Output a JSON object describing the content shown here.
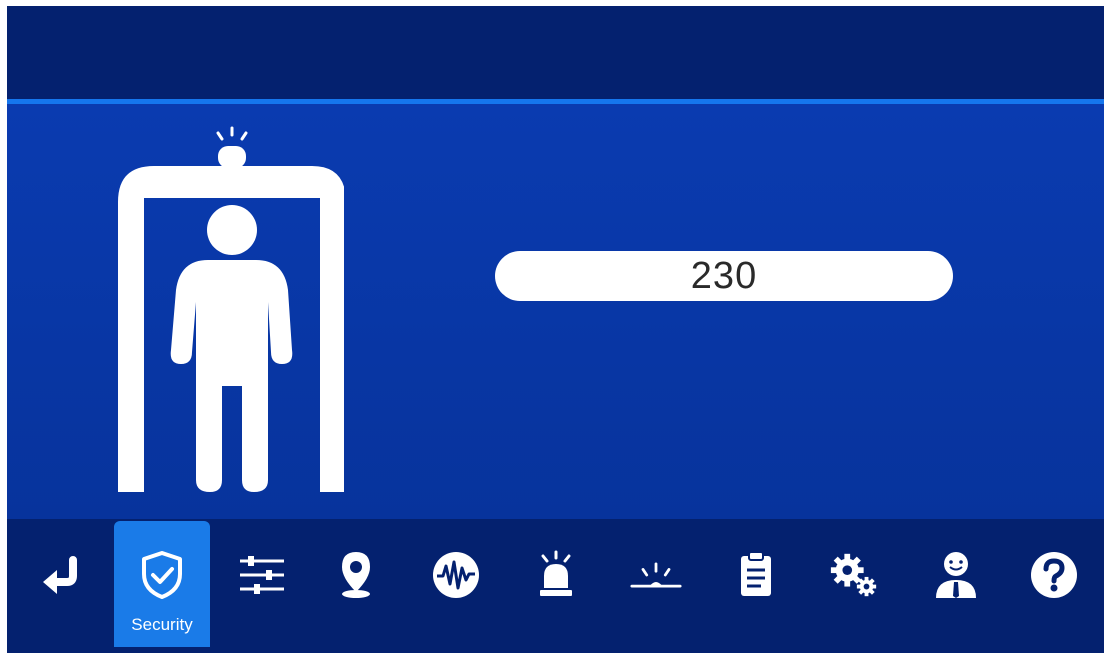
{
  "reading": {
    "value": "230"
  },
  "nav": {
    "items": [
      {
        "icon": "return-icon"
      },
      {
        "icon": "shield-check-icon",
        "label": "Security",
        "active": true
      },
      {
        "icon": "sliders-icon"
      },
      {
        "icon": "location-pin-icon"
      },
      {
        "icon": "waveform-icon"
      },
      {
        "icon": "alarm-light-icon"
      },
      {
        "icon": "indicator-light-icon"
      },
      {
        "icon": "clipboard-icon"
      },
      {
        "icon": "gears-icon"
      },
      {
        "icon": "user-icon"
      },
      {
        "icon": "help-icon"
      }
    ]
  },
  "colors": {
    "topbar": "#04216f",
    "accent_line": "#1576ee",
    "main_bg": "#0a3bb0",
    "active_tab": "#1a7be8"
  }
}
